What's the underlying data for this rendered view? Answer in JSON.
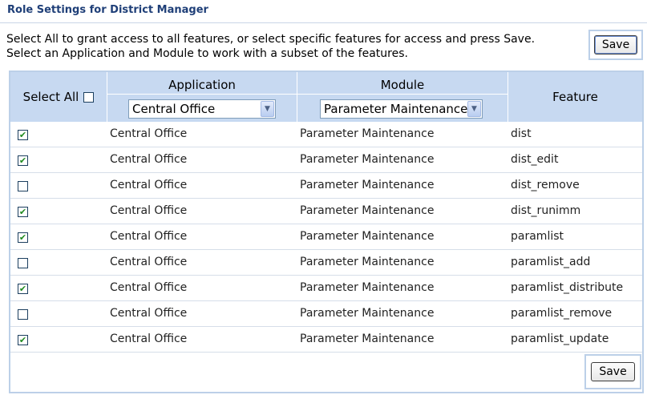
{
  "page": {
    "title": "Role Settings for District Manager",
    "instructions_line1": "Select All to grant access to all features, or select specific features for access and press Save.",
    "instructions_line2": "Select an Application and Module to work with a subset of the features.",
    "save_label": "Save"
  },
  "table": {
    "headers": {
      "select_all": "Select All",
      "application": "Application",
      "module": "Module",
      "feature": "Feature"
    },
    "select_all_checked": false,
    "filters": {
      "application": "Central Office",
      "module": "Parameter Maintenance"
    },
    "rows": [
      {
        "checked": true,
        "application": "Central Office",
        "module": "Parameter Maintenance",
        "feature": "dist"
      },
      {
        "checked": true,
        "application": "Central Office",
        "module": "Parameter Maintenance",
        "feature": "dist_edit"
      },
      {
        "checked": false,
        "application": "Central Office",
        "module": "Parameter Maintenance",
        "feature": "dist_remove"
      },
      {
        "checked": true,
        "application": "Central Office",
        "module": "Parameter Maintenance",
        "feature": "dist_runimm"
      },
      {
        "checked": true,
        "application": "Central Office",
        "module": "Parameter Maintenance",
        "feature": "paramlist"
      },
      {
        "checked": false,
        "application": "Central Office",
        "module": "Parameter Maintenance",
        "feature": "paramlist_add"
      },
      {
        "checked": true,
        "application": "Central Office",
        "module": "Parameter Maintenance",
        "feature": "paramlist_distribute"
      },
      {
        "checked": false,
        "application": "Central Office",
        "module": "Parameter Maintenance",
        "feature": "paramlist_remove"
      },
      {
        "checked": true,
        "application": "Central Office",
        "module": "Parameter Maintenance",
        "feature": "paramlist_update"
      }
    ]
  },
  "colors": {
    "title": "#1f3f78",
    "header_bg": "#c7d9f1",
    "frame": "#bcd0e8",
    "check": "#1f8a1f"
  },
  "icons": {
    "checked": "checkmark-icon",
    "dropdown": "chevron-down-icon"
  }
}
